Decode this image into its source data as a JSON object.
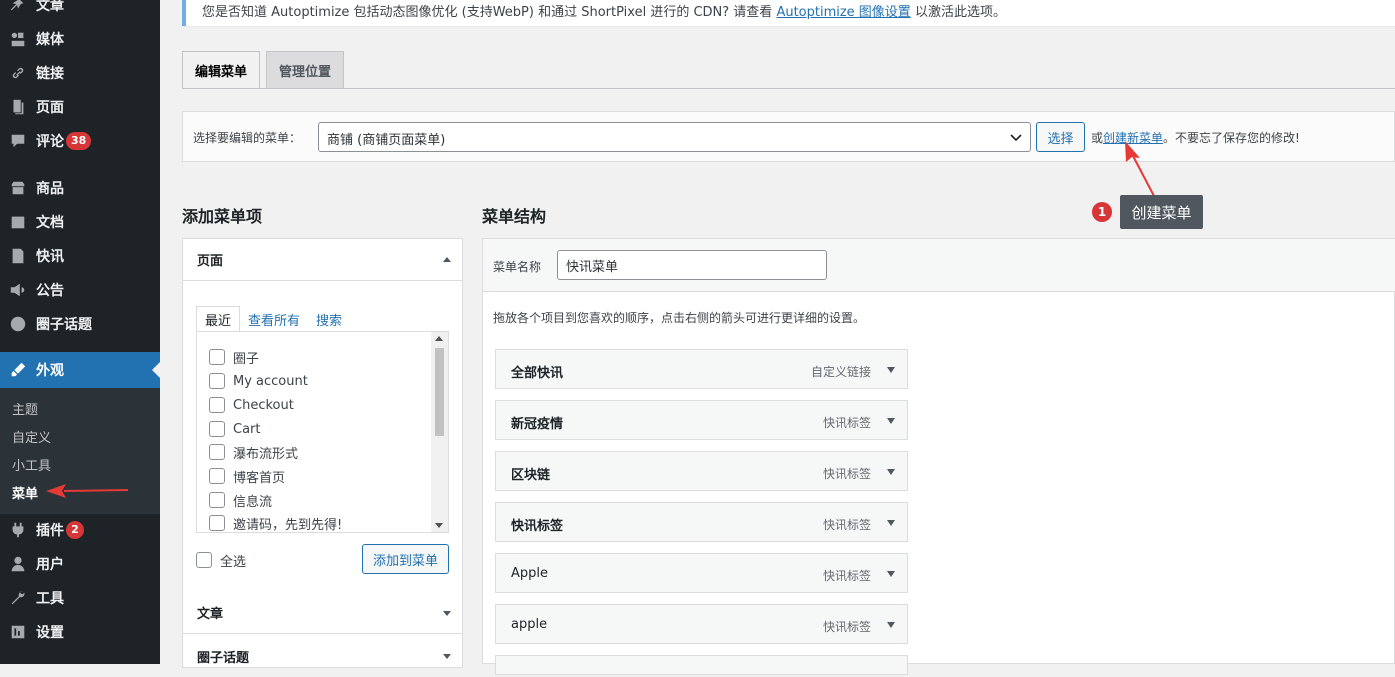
{
  "sidebar": {
    "items": [
      {
        "label": "文章",
        "icon": "pushpin-icon"
      },
      {
        "label": "媒体",
        "icon": "media-icon"
      },
      {
        "label": "链接",
        "icon": "link-icon"
      },
      {
        "label": "页面",
        "icon": "page-icon"
      },
      {
        "label": "评论",
        "icon": "comment-icon",
        "badge": "38"
      },
      {
        "label": "商品",
        "icon": "store-icon"
      },
      {
        "label": "文档",
        "icon": "document-icon"
      },
      {
        "label": "快讯",
        "icon": "news-icon"
      },
      {
        "label": "公告",
        "icon": "megaphone-icon"
      },
      {
        "label": "圈子话题",
        "icon": "accessibility-icon"
      },
      {
        "label": "外观",
        "icon": "appearance-icon"
      },
      {
        "label": "插件",
        "icon": "plugin-icon",
        "badge": "2"
      },
      {
        "label": "用户",
        "icon": "user-icon"
      },
      {
        "label": "工具",
        "icon": "wrench-icon"
      },
      {
        "label": "设置",
        "icon": "settings-icon"
      }
    ],
    "submenu": [
      "主题",
      "自定义",
      "小工具",
      "菜单"
    ]
  },
  "notice": {
    "text": "您是否知道 Autoptimize 包括动态图像优化 (支持WebP) 和通过 ShortPixel 进行的 CDN? 请查看 ",
    "link": "Autoptimize 图像设置",
    "suffix": " 以激活此选项。"
  },
  "tabs": [
    "编辑菜单",
    "管理位置"
  ],
  "menu_select": {
    "label": "选择要编辑的菜单：",
    "value": "商铺 (商铺页面菜单)",
    "button": "选择",
    "or": "或",
    "create_link": "创建新菜单",
    "reminder": "。不要忘了保存您的修改!"
  },
  "callout": {
    "number": "1",
    "text": "创建菜单"
  },
  "add_items": {
    "heading": "添加菜单项",
    "pages_title": "页面",
    "subtabs": [
      "最近",
      "查看所有",
      "搜索"
    ],
    "pages": [
      "圈子",
      "My account",
      "Checkout",
      "Cart",
      "瀑布流形式",
      "博客首页",
      "信息流",
      "邀请码，先到先得!"
    ],
    "select_all": "全选",
    "add_button": "添加到菜单",
    "sections": [
      "文章",
      "圈子话题"
    ]
  },
  "structure": {
    "heading": "菜单结构",
    "name_label": "菜单名称",
    "name_value": "快讯菜单",
    "hint": "拖放各个项目到您喜欢的顺序，点击右侧的箭头可进行更详细的设置。",
    "items": [
      {
        "title": "全部快讯",
        "type": "自定义链接"
      },
      {
        "title": "新冠疫情",
        "type": "快讯标签"
      },
      {
        "title": "区块链",
        "type": "快讯标签"
      },
      {
        "title": "快讯标签",
        "type": "快讯标签"
      },
      {
        "title": "Apple",
        "type": "快讯标签"
      },
      {
        "title": "apple",
        "type": "快讯标签"
      }
    ]
  },
  "colors": {
    "accent": "#2271b1",
    "sidebar_bg": "#1d2327",
    "badge": "#d63638",
    "arrow_red": "#e53935"
  }
}
